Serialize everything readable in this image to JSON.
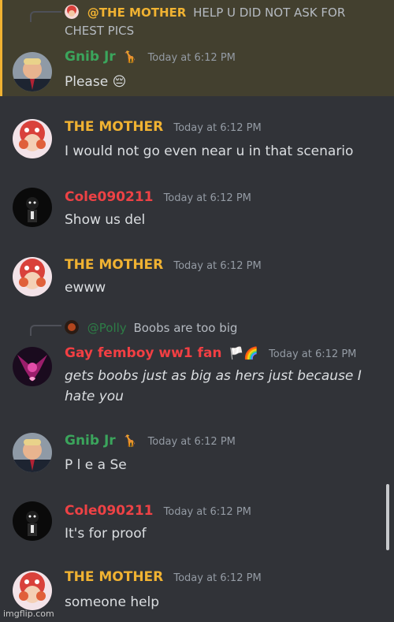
{
  "colors": {
    "background": "#313338",
    "highlight": "#43402f",
    "mention_bar": "#f0b232",
    "green_name": "#3ba55c",
    "yellow_name": "#f0b232",
    "red_name": "#ed4245",
    "pink_name": "#f23f43",
    "timestamp": "#949ba4"
  },
  "reply_top": {
    "mention": "@THE MOTHER",
    "text_line1": "HELP U DID NOT ASK FOR",
    "text_line2": "CHEST PICS"
  },
  "messages": [
    {
      "author": "Gnib Jr",
      "emoji": "🦒",
      "time": "Today at 6:12 PM",
      "text": "Please 😔"
    },
    {
      "author": "THE MOTHER",
      "time": "Today at 6:12 PM",
      "text": "I would not go even near u in that scenario"
    },
    {
      "author": "Cole090211",
      "time": "Today at 6:12 PM",
      "text": "Show us del"
    },
    {
      "author": "THE MOTHER",
      "time": "Today at 6:12 PM",
      "text": "ewww"
    },
    {
      "author": "Gay femboy ww1 fan",
      "emoji": "🏳️🌈",
      "time": "Today at 6:12 PM",
      "text_line1": "gets boobs just as big as hers just because I",
      "text_line2": "hate you"
    },
    {
      "author": "Gnib Jr",
      "emoji": "🦒",
      "time": "Today at 6:12 PM",
      "text": "P l e a Se"
    },
    {
      "author": "Cole090211",
      "time": "Today at 6:12 PM",
      "text": "It's for proof"
    },
    {
      "author": "THE MOTHER",
      "time": "Today at 6:12 PM",
      "text": "someone help"
    }
  ],
  "reply_polly": {
    "mention": "@Polly",
    "text": "Boobs are too big"
  },
  "watermark": "imgflip.com"
}
